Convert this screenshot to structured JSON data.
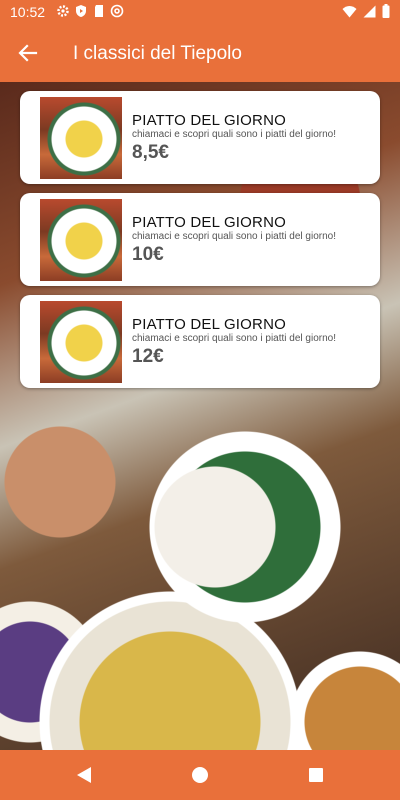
{
  "status_bar": {
    "time": "10:52",
    "icons": [
      "settings-icon",
      "shield-icon",
      "sd-card-icon",
      "at-icon",
      "wifi-icon",
      "signal-icon",
      "battery-icon"
    ]
  },
  "app_bar": {
    "title": "I classici del Tiepolo",
    "back_icon": "arrow-back-icon"
  },
  "colors": {
    "primary": "#e9703a",
    "card_bg": "#ffffff",
    "text_dark": "#111111",
    "text_muted": "#555555"
  },
  "items": [
    {
      "name": "PIATTO DEL GIORNO",
      "description": "chiamaci e scopri quali sono i piatti del giorno!",
      "price": "8,5€"
    },
    {
      "name": "PIATTO DEL GIORNO",
      "description": "chiamaci e scopri quali sono i piatti del giorno!",
      "price": "10€"
    },
    {
      "name": "PIATTO DEL GIORNO",
      "description": "chiamaci e scopri quali sono i piatti del giorno!",
      "price": "12€"
    }
  ],
  "nav_bar": {
    "buttons": [
      "back-triangle-icon",
      "home-circle-icon",
      "recents-square-icon"
    ]
  }
}
